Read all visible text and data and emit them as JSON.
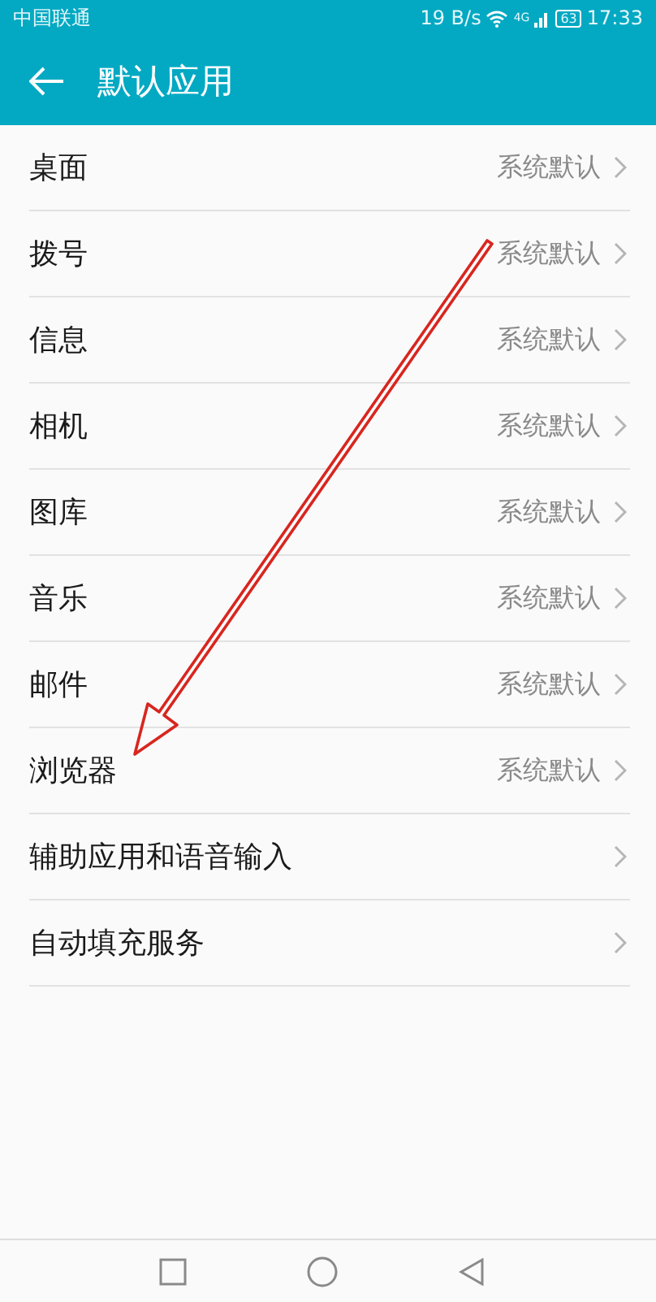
{
  "status_bar": {
    "carrier": "中国联通",
    "speed": "19 B/s",
    "network": "4G",
    "battery": "63",
    "time": "17:33"
  },
  "app_bar": {
    "title": "默认应用"
  },
  "items": [
    {
      "label": "桌面",
      "value": "系统默认"
    },
    {
      "label": "拨号",
      "value": "系统默认"
    },
    {
      "label": "信息",
      "value": "系统默认"
    },
    {
      "label": "相机",
      "value": "系统默认"
    },
    {
      "label": "图库",
      "value": "系统默认"
    },
    {
      "label": "音乐",
      "value": "系统默认"
    },
    {
      "label": "邮件",
      "value": "系统默认"
    },
    {
      "label": "浏览器",
      "value": "系统默认"
    },
    {
      "label": "辅助应用和语音输入"
    },
    {
      "label": "自动填充服务"
    }
  ]
}
